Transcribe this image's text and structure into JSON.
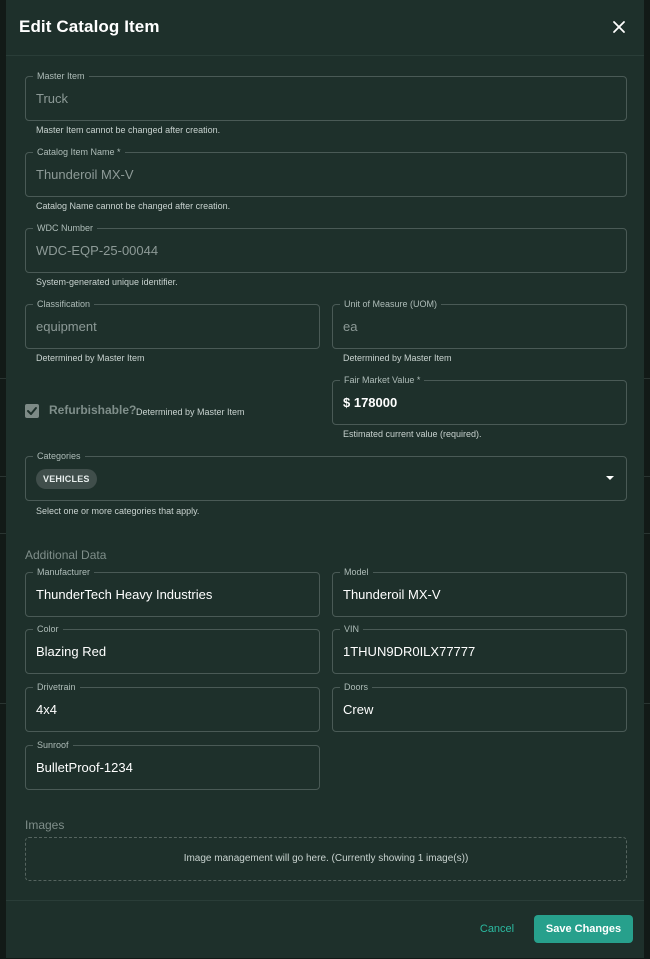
{
  "dialog": {
    "title": "Edit Catalog Item",
    "close_icon": "close-icon"
  },
  "fields": {
    "master_item": {
      "label": "Master Item",
      "value": "Truck",
      "helper": "Master Item cannot be changed after creation."
    },
    "catalog_item_name": {
      "label": "Catalog Item Name *",
      "value": "Thunderoil MX-V",
      "helper": "Catalog Name cannot be changed after creation."
    },
    "wdc_number": {
      "label": "WDC Number",
      "value": "WDC-EQP-25-00044",
      "helper": "System-generated unique identifier."
    },
    "classification": {
      "label": "Classification",
      "value": "equipment",
      "helper": "Determined by Master Item"
    },
    "uom": {
      "label": "Unit of Measure (UOM)",
      "value": "ea",
      "helper": "Determined by Master Item"
    },
    "refurbishable": {
      "label": "Refurbishable?",
      "helper": "Determined by Master Item",
      "checked": true
    },
    "fair_market_value": {
      "label": "Fair Market Value *",
      "value": "$ 178000",
      "helper": "Estimated current value (required)."
    },
    "categories": {
      "label": "Categories",
      "chips": [
        "VEHICLES"
      ],
      "helper": "Select one or more categories that apply."
    }
  },
  "additional_data": {
    "title": "Additional Data",
    "manufacturer": {
      "label": "Manufacturer",
      "value": "ThunderTech Heavy Industries"
    },
    "model": {
      "label": "Model",
      "value": "Thunderoil MX-V"
    },
    "color": {
      "label": "Color",
      "value": "Blazing Red"
    },
    "vin": {
      "label": "VIN",
      "value": "1THUN9DR0ILX77777"
    },
    "drivetrain": {
      "label": "Drivetrain",
      "value": "4x4"
    },
    "doors": {
      "label": "Doors",
      "value": "Crew"
    },
    "sunroof": {
      "label": "Sunroof",
      "value": "BulletProof-1234"
    }
  },
  "images": {
    "title": "Images",
    "placeholder": "Image management will go here. (Currently showing 1 image(s))"
  },
  "footer": {
    "cancel_label": "Cancel",
    "save_label": "Save Changes"
  },
  "colors": {
    "dialog_bg": "#1e302b",
    "accent": "#27a08c",
    "cancel_text": "#2bb9a0"
  }
}
